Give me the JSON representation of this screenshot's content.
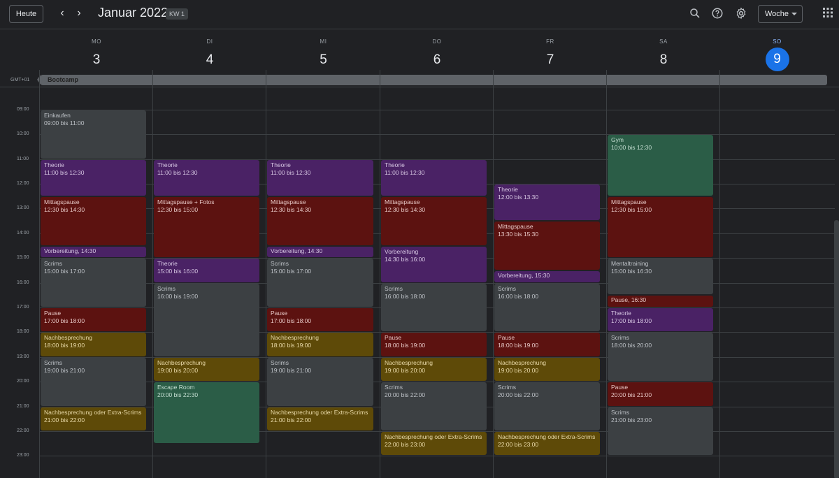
{
  "header": {
    "today_label": "Heute",
    "prev_label": "‹",
    "next_label": "›",
    "month_title": "Januar 2022",
    "week_badge": "KW 1",
    "view_label": "Woche",
    "icons": [
      "search-icon",
      "help-icon",
      "settings-icon",
      "apps-icon"
    ]
  },
  "days": [
    {
      "name": "MO",
      "num": "3"
    },
    {
      "name": "DI",
      "num": "4"
    },
    {
      "name": "MI",
      "num": "5"
    },
    {
      "name": "DO",
      "num": "6"
    },
    {
      "name": "FR",
      "num": "7"
    },
    {
      "name": "SA",
      "num": "8"
    },
    {
      "name": "SO",
      "num": "9",
      "today": true
    }
  ],
  "timezone": "GMT+01",
  "allday_event": "Bootcamp",
  "time_labels": [
    "09:00",
    "10:00",
    "11:00",
    "12:00",
    "13:00",
    "14:00",
    "15:00",
    "16:00",
    "17:00",
    "18:00",
    "19:00",
    "20:00",
    "21:00",
    "22:00",
    "23:00"
  ],
  "colors": {
    "gray": "#3c4043",
    "purple": "#4a2265",
    "red": "#5c1210",
    "yellow": "#5e4a08",
    "green": "#2b5d47",
    "today_blue": "#1a73e8"
  },
  "events": [
    {
      "day": 0,
      "start": 9,
      "end": 11,
      "title": "Einkaufen",
      "time": "09:00 bis 11:00",
      "color": "gray"
    },
    {
      "day": 0,
      "start": 11,
      "end": 12.5,
      "title": "Theorie",
      "time": "11:00 bis 12:30",
      "color": "purple"
    },
    {
      "day": 0,
      "start": 12.5,
      "end": 14.5,
      "title": "Mittagspause",
      "time": "12:30 bis 14:30",
      "color": "red"
    },
    {
      "day": 0,
      "start": 14.5,
      "end": 15,
      "title": "Vorbereitung, 14:30",
      "time": "",
      "color": "purple"
    },
    {
      "day": 0,
      "start": 15,
      "end": 17,
      "title": "Scrims",
      "time": "15:00 bis 17:00",
      "color": "gray"
    },
    {
      "day": 0,
      "start": 17,
      "end": 18,
      "title": "Pause",
      "time": "17:00 bis 18:00",
      "color": "red"
    },
    {
      "day": 0,
      "start": 18,
      "end": 19,
      "title": "Nachbesprechung",
      "time": "18:00 bis 19:00",
      "color": "yellow"
    },
    {
      "day": 0,
      "start": 19,
      "end": 21,
      "title": "Scrims",
      "time": "19:00 bis 21:00",
      "color": "gray"
    },
    {
      "day": 0,
      "start": 21,
      "end": 22,
      "title": "Nachbesprechung oder Extra-Scrims",
      "time": "21:00 bis 22:00",
      "color": "yellow"
    },
    {
      "day": 1,
      "start": 11,
      "end": 12.5,
      "title": "Theorie",
      "time": "11:00 bis 12:30",
      "color": "purple"
    },
    {
      "day": 1,
      "start": 12.5,
      "end": 15,
      "title": "Mittagspause + Fotos",
      "time": "12:30 bis 15:00",
      "color": "red"
    },
    {
      "day": 1,
      "start": 15,
      "end": 16,
      "title": "Theorie",
      "time": "15:00 bis 16:00",
      "color": "purple"
    },
    {
      "day": 1,
      "start": 16,
      "end": 19,
      "title": "Scrims",
      "time": "16:00 bis 19:00",
      "color": "gray"
    },
    {
      "day": 1,
      "start": 19,
      "end": 20,
      "title": "Nachbesprechung",
      "time": "19:00 bis 20:00",
      "color": "yellow"
    },
    {
      "day": 1,
      "start": 20,
      "end": 22.5,
      "title": "Escape Room",
      "time": "20:00 bis 22:30",
      "color": "green"
    },
    {
      "day": 2,
      "start": 11,
      "end": 12.5,
      "title": "Theorie",
      "time": "11:00 bis 12:30",
      "color": "purple"
    },
    {
      "day": 2,
      "start": 12.5,
      "end": 14.5,
      "title": "Mittagspause",
      "time": "12:30 bis 14:30",
      "color": "red"
    },
    {
      "day": 2,
      "start": 14.5,
      "end": 15,
      "title": "Vorbereitung, 14:30",
      "time": "",
      "color": "purple"
    },
    {
      "day": 2,
      "start": 15,
      "end": 17,
      "title": "Scrims",
      "time": "15:00 bis 17:00",
      "color": "gray"
    },
    {
      "day": 2,
      "start": 17,
      "end": 18,
      "title": "Pause",
      "time": "17:00 bis 18:00",
      "color": "red"
    },
    {
      "day": 2,
      "start": 18,
      "end": 19,
      "title": "Nachbesprechung",
      "time": "18:00 bis 19:00",
      "color": "yellow"
    },
    {
      "day": 2,
      "start": 19,
      "end": 21,
      "title": "Scrims",
      "time": "19:00 bis 21:00",
      "color": "gray"
    },
    {
      "day": 2,
      "start": 21,
      "end": 22,
      "title": "Nachbesprechung oder Extra-Scrims",
      "time": "21:00 bis 22:00",
      "color": "yellow"
    },
    {
      "day": 3,
      "start": 11,
      "end": 12.5,
      "title": "Theorie",
      "time": "11:00 bis 12:30",
      "color": "purple"
    },
    {
      "day": 3,
      "start": 12.5,
      "end": 14.5,
      "title": "Mittagspause",
      "time": "12:30 bis 14:30",
      "color": "red"
    },
    {
      "day": 3,
      "start": 14.5,
      "end": 16,
      "title": "Vorbereitung",
      "time": "14:30 bis 16:00",
      "color": "purple"
    },
    {
      "day": 3,
      "start": 16,
      "end": 18,
      "title": "Scrims",
      "time": "16:00 bis 18:00",
      "color": "gray"
    },
    {
      "day": 3,
      "start": 18,
      "end": 19,
      "title": "Pause",
      "time": "18:00 bis 19:00",
      "color": "red"
    },
    {
      "day": 3,
      "start": 19,
      "end": 20,
      "title": "Nachbesprechung",
      "time": "19:00 bis 20:00",
      "color": "yellow"
    },
    {
      "day": 3,
      "start": 20,
      "end": 22,
      "title": "Scrims",
      "time": "20:00 bis 22:00",
      "color": "gray"
    },
    {
      "day": 3,
      "start": 22,
      "end": 23,
      "title": "Nachbesprechung oder Extra-Scrims",
      "time": "22:00 bis 23:00",
      "color": "yellow"
    },
    {
      "day": 4,
      "start": 12,
      "end": 13.5,
      "title": "Theorie",
      "time": "12:00 bis 13:30",
      "color": "purple"
    },
    {
      "day": 4,
      "start": 13.5,
      "end": 15.5,
      "title": "Mittagspause",
      "time": "13:30 bis 15:30",
      "color": "red"
    },
    {
      "day": 4,
      "start": 15.5,
      "end": 16,
      "title": "Vorbereitung, 15:30",
      "time": "",
      "color": "purple"
    },
    {
      "day": 4,
      "start": 16,
      "end": 18,
      "title": "Scrims",
      "time": "16:00 bis 18:00",
      "color": "gray"
    },
    {
      "day": 4,
      "start": 18,
      "end": 19,
      "title": "Pause",
      "time": "18:00 bis 19:00",
      "color": "red"
    },
    {
      "day": 4,
      "start": 19,
      "end": 20,
      "title": "Nachbesprechung",
      "time": "19:00 bis 20:00",
      "color": "yellow"
    },
    {
      "day": 4,
      "start": 20,
      "end": 22,
      "title": "Scrims",
      "time": "20:00 bis 22:00",
      "color": "gray"
    },
    {
      "day": 4,
      "start": 22,
      "end": 23,
      "title": "Nachbesprechung oder Extra-Scrims",
      "time": "22:00 bis 23:00",
      "color": "yellow"
    },
    {
      "day": 5,
      "start": 10,
      "end": 12.5,
      "title": "Gym",
      "time": "10:00 bis 12:30",
      "color": "green"
    },
    {
      "day": 5,
      "start": 12.5,
      "end": 15,
      "title": "Mittagspause",
      "time": "12:30 bis 15:00",
      "color": "red"
    },
    {
      "day": 5,
      "start": 15,
      "end": 16.5,
      "title": "Mentaltraining",
      "time": "15:00 bis 16:30",
      "color": "gray"
    },
    {
      "day": 5,
      "start": 16.5,
      "end": 17,
      "title": "Pause, 16:30",
      "time": "",
      "color": "red"
    },
    {
      "day": 5,
      "start": 17,
      "end": 18,
      "title": "Theorie",
      "time": "17:00 bis 18:00",
      "color": "purple"
    },
    {
      "day": 5,
      "start": 18,
      "end": 20,
      "title": "Scrims",
      "time": "18:00 bis 20:00",
      "color": "gray"
    },
    {
      "day": 5,
      "start": 20,
      "end": 21,
      "title": "Pause",
      "time": "20:00 bis 21:00",
      "color": "red"
    },
    {
      "day": 5,
      "start": 21,
      "end": 23,
      "title": "Scrims",
      "time": "21:00 bis 23:00",
      "color": "gray"
    }
  ]
}
